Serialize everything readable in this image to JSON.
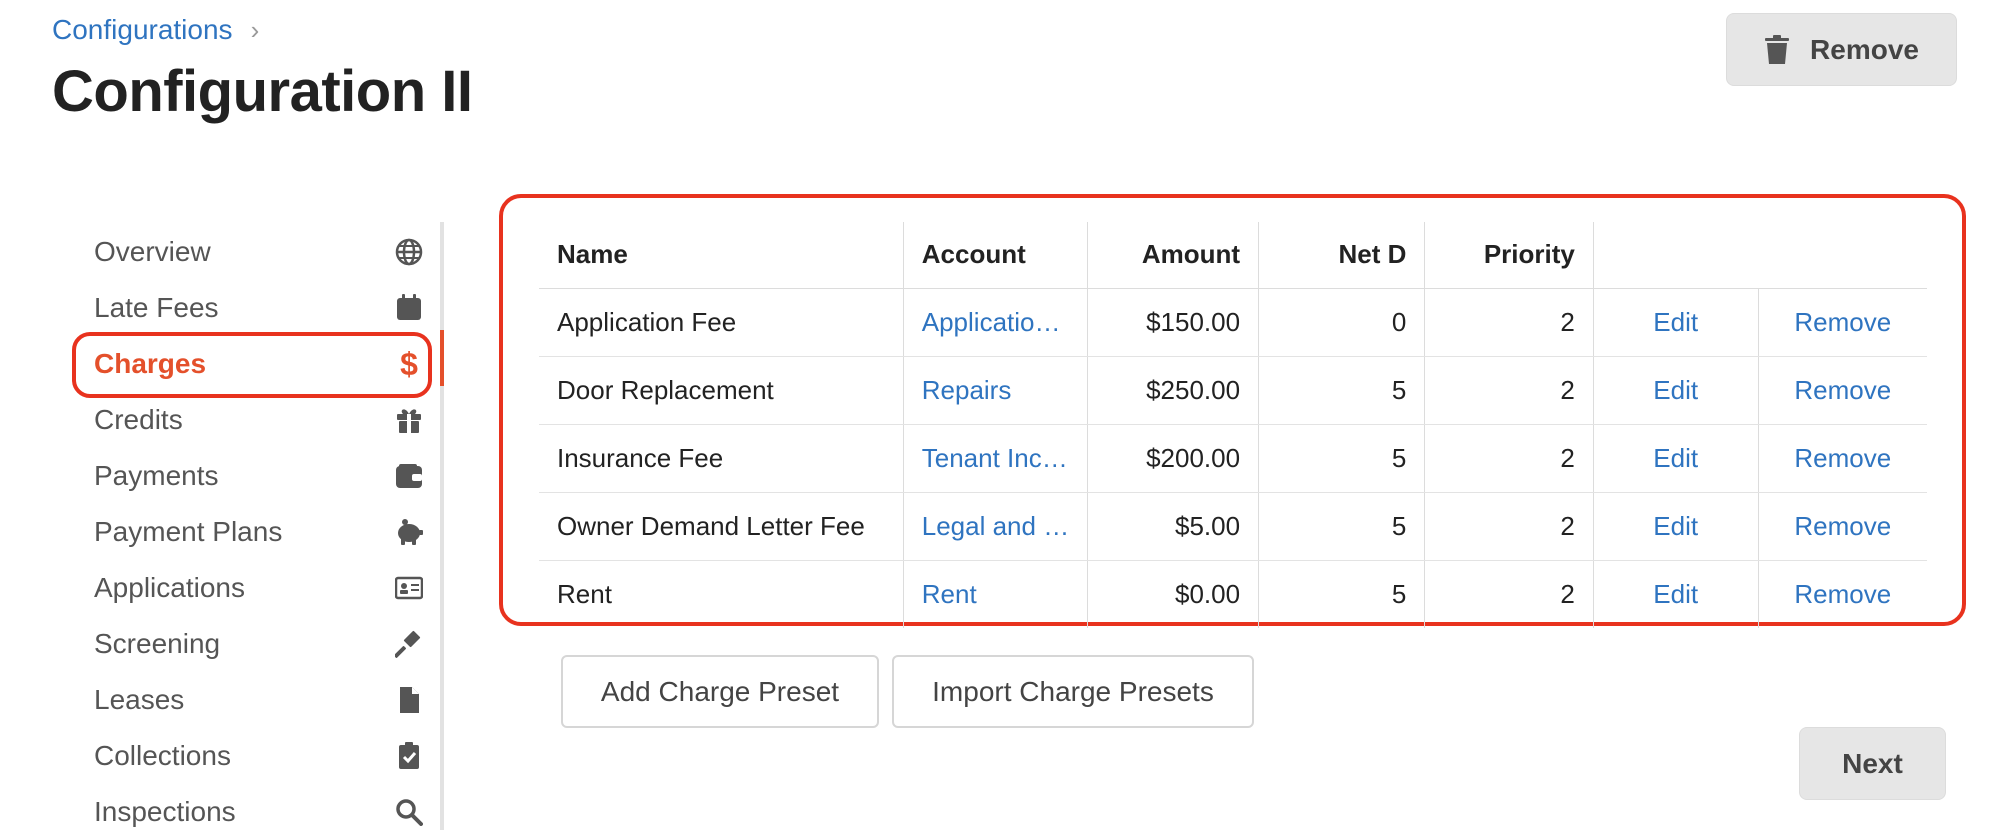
{
  "breadcrumb": {
    "parent": "Configurations",
    "separator": "›"
  },
  "page_title": "Configuration II",
  "header": {
    "remove_label": "Remove"
  },
  "sidebar": {
    "items": [
      {
        "label": "Overview",
        "icon": "globe-icon"
      },
      {
        "label": "Late Fees",
        "icon": "calendar-icon"
      },
      {
        "label": "Charges",
        "icon": "dollar-icon",
        "glyph": "$",
        "active": true
      },
      {
        "label": "Credits",
        "icon": "gift-icon"
      },
      {
        "label": "Payments",
        "icon": "wallet-icon"
      },
      {
        "label": "Payment Plans",
        "icon": "piggy-bank-icon"
      },
      {
        "label": "Applications",
        "icon": "id-card-icon"
      },
      {
        "label": "Screening",
        "icon": "gavel-icon"
      },
      {
        "label": "Leases",
        "icon": "file-icon"
      },
      {
        "label": "Collections",
        "icon": "clipboard-check-icon"
      },
      {
        "label": "Inspections",
        "icon": "search-icon"
      }
    ]
  },
  "table": {
    "headers": [
      "Name",
      "Account",
      "Amount",
      "Net D",
      "Priority"
    ],
    "rows": [
      {
        "name": "Application Fee",
        "account": "Applicatio…",
        "amount": "$150.00",
        "net_d": "0",
        "priority": "2",
        "edit": "Edit",
        "remove": "Remove"
      },
      {
        "name": "Door Replacement",
        "account": "Repairs",
        "amount": "$250.00",
        "net_d": "5",
        "priority": "2",
        "edit": "Edit",
        "remove": "Remove"
      },
      {
        "name": "Insurance Fee",
        "account": "Tenant Inc…",
        "amount": "$200.00",
        "net_d": "5",
        "priority": "2",
        "edit": "Edit",
        "remove": "Remove"
      },
      {
        "name": "Owner Demand Letter Fee",
        "account": "Legal and …",
        "amount": "$5.00",
        "net_d": "5",
        "priority": "2",
        "edit": "Edit",
        "remove": "Remove"
      },
      {
        "name": "Rent",
        "account": "Rent",
        "amount": "$0.00",
        "net_d": "5",
        "priority": "2",
        "edit": "Edit",
        "remove": "Remove"
      }
    ]
  },
  "actions": {
    "add_label": "Add Charge Preset",
    "import_label": "Import Charge Presets",
    "next_label": "Next"
  },
  "colors": {
    "accent": "#e4502b",
    "link": "#2f74c0",
    "highlight": "#e8321e"
  }
}
